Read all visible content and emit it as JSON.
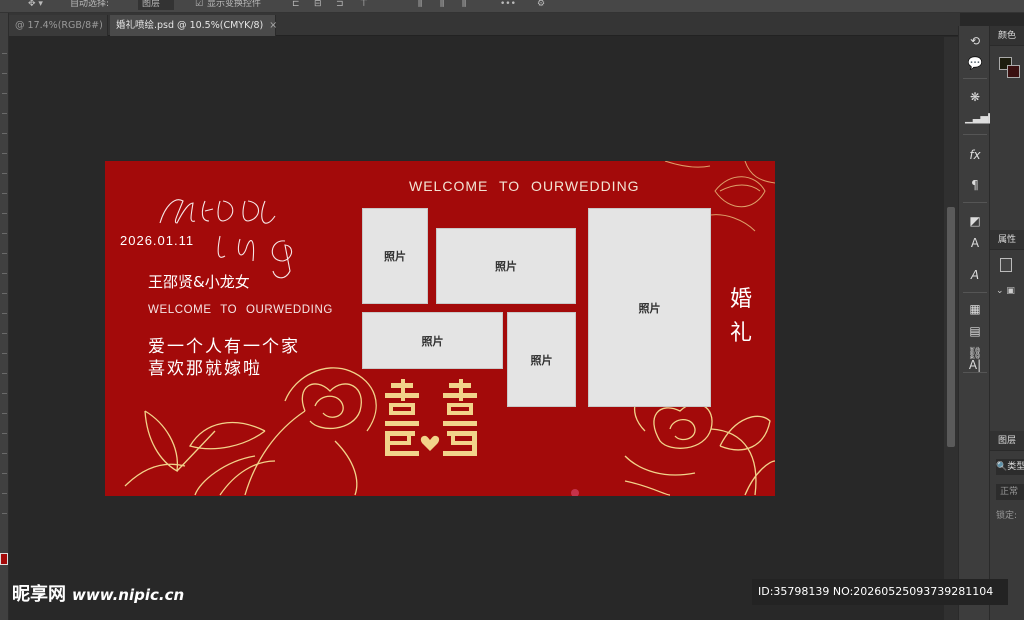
{
  "app": {
    "toolbar_fragments": [
      "自动选择:",
      "图层",
      "显示变换控件"
    ]
  },
  "tabs": [
    {
      "label": "@ 17.4%(RGB/8#)",
      "active": false
    },
    {
      "label": "婚礼喷绘.psd @ 10.5%(CMYK/8)",
      "active": true
    }
  ],
  "right_panels": {
    "color_title": "颜色",
    "props_title": "属性",
    "layers_title": "图层",
    "layers_search": "类型",
    "blend_mode": "正常",
    "lock_label": "锁定:"
  },
  "artboard": {
    "script_title_line1": "WEDD",
    "script_title_line2": "ING",
    "date": "2026.01.11",
    "names": "王邵贤&小龙女",
    "welcome_sub": "WELCOME TO OURWEDDING",
    "welcome_top": "WELCOME TO OURWEDDING",
    "slogan_line1": "爱一个人有一个家",
    "slogan_line2": "喜欢那就嫁啦",
    "vertical_title": [
      "婚",
      "礼"
    ],
    "double_happiness": "囍",
    "photo_label": "照片",
    "photos": [
      "照片",
      "照片",
      "照片",
      "照片",
      "照片"
    ]
  },
  "watermark": {
    "brand": "昵享网",
    "site": "www.nipic.cn",
    "id_text": "ID:35798139 NO:20260525093739281104"
  },
  "colors": {
    "artboard_red": "#a30a0a",
    "gold": "#f2d38a",
    "photo_gray": "#e4e4e4"
  },
  "icons": [
    "move-icon",
    "adjust-icon",
    "comment-icon",
    "snowflake-icon",
    "histogram-icon",
    "fx-icon",
    "paragraph-icon",
    "layers-icon",
    "character-icon",
    "glyphs-icon",
    "table-icon",
    "notes-icon",
    "link-icon",
    "text-icon"
  ]
}
